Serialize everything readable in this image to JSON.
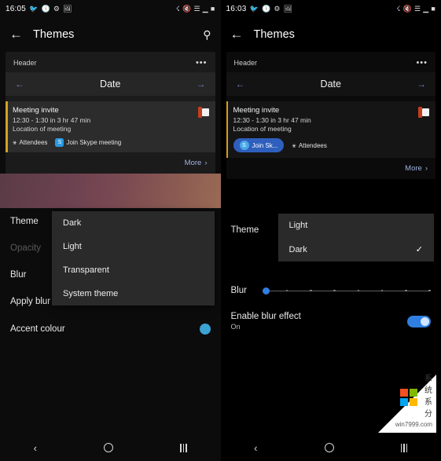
{
  "left": {
    "status": {
      "time": "16:05",
      "icons": [
        "twitter-icon",
        "clock-icon",
        "settings-icon",
        "image-icon",
        "bluetooth-icon",
        "mute-icon",
        "wifi-icon",
        "signal-icon",
        "battery-icon"
      ]
    },
    "appbar": {
      "back": "←",
      "title": "Themes",
      "search": "⚲"
    },
    "preview": {
      "header_label": "Header",
      "overflow": "•••",
      "prev_arrow": "←",
      "date_label": "Date",
      "next_arrow": "→",
      "event": {
        "title": "Meeting invite",
        "time": "12:30 - 1:30  in 3 hr 47 min",
        "location": "Location of meeting",
        "attendees_label": "Attendees",
        "skype_label": "Join Skype meeting",
        "skype_initial": "S",
        "person_icon": "⚹"
      },
      "more_label": "More",
      "more_chevron": "›"
    },
    "settings": {
      "theme_label": "Theme",
      "opacity_label": "Opacity",
      "blur_label": "Blur",
      "apply_blur_label": "Apply blur ef",
      "accent_label": "Accent colour",
      "accent_colour": "#3ba3d4"
    },
    "dropdown": {
      "items": [
        {
          "label": "Dark",
          "checked": false
        },
        {
          "label": "Light",
          "checked": false
        },
        {
          "label": "Transparent",
          "checked": false
        },
        {
          "label": "System theme",
          "checked": false
        }
      ]
    },
    "nav": {
      "back": "‹",
      "home": "home-circle",
      "recents": "recents-lines"
    }
  },
  "right": {
    "status": {
      "time": "16:03",
      "icons": [
        "twitter-icon",
        "clock-icon",
        "settings-icon",
        "image-icon",
        "bluetooth-icon",
        "mute-icon",
        "wifi-icon",
        "signal-icon",
        "battery-icon"
      ]
    },
    "appbar": {
      "back": "←",
      "title": "Themes"
    },
    "preview": {
      "header_label": "Header",
      "overflow": "•••",
      "prev_arrow": "←",
      "date_label": "Date",
      "next_arrow": "→",
      "event": {
        "title": "Meeting invite",
        "time": "12:30 - 1:30  in 3 hr 47 min",
        "location": "Location of meeting",
        "skype_label": "Join Sk...",
        "skype_initial": "S",
        "attendees_label": "Attendees",
        "person_icon": "⚹"
      },
      "more_label": "More",
      "more_chevron": "›"
    },
    "settings": {
      "theme_label": "Theme",
      "blur_label": "Blur",
      "blur_toggle_label": "Enable blur effect",
      "blur_toggle_state": "On"
    },
    "dropdown": {
      "items": [
        {
          "label": "Light",
          "checked": false
        },
        {
          "label": "Dark",
          "checked": true
        }
      ],
      "check_glyph": "✓"
    },
    "slider": {
      "value": 0,
      "ticks": 8
    },
    "nav": {
      "back": "‹",
      "home": "home-circle",
      "recents": "recents-lines"
    },
    "watermark": {
      "line1": "系统系分",
      "line2": "win7999.com"
    }
  }
}
